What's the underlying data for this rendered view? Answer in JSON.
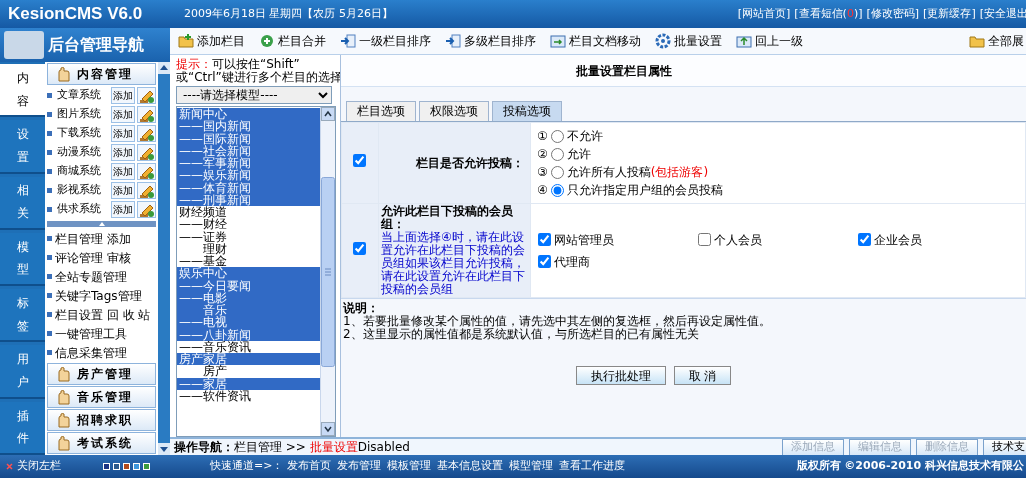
{
  "header": {
    "logo": "KesionCMS V6.0",
    "date": "2009年6月18日 星期四【农历 5月26日】",
    "links": [
      {
        "text": "[网站首页]"
      },
      {
        "text": "[查看短信(",
        "count": "0",
        "after": ")]"
      },
      {
        "text": "[修改密码]"
      },
      {
        "text": "[更新缓存]"
      },
      {
        "text": "[安全退出"
      }
    ]
  },
  "sidebar": {
    "title": "后台管理导航",
    "vtabs": [
      {
        "label": "内容",
        "selected": true
      },
      {
        "label": "设置",
        "selected": false
      },
      {
        "label": "相关",
        "selected": false
      },
      {
        "label": "模型",
        "selected": false
      },
      {
        "label": "标签",
        "selected": false
      },
      {
        "label": "用户",
        "selected": false
      },
      {
        "label": "插件",
        "selected": false
      }
    ],
    "menu": [
      {
        "kind": "header",
        "label": "内容管理"
      },
      {
        "kind": "system",
        "label": "文章系统",
        "button": "添加"
      },
      {
        "kind": "system",
        "label": "图片系统",
        "button": "添加"
      },
      {
        "kind": "system",
        "label": "下载系统",
        "button": "添加"
      },
      {
        "kind": "system",
        "label": "动漫系统",
        "button": "添加"
      },
      {
        "kind": "system",
        "label": "商城系统",
        "button": "添加"
      },
      {
        "kind": "system",
        "label": "影视系统",
        "button": "添加"
      },
      {
        "kind": "system",
        "label": "供求系统",
        "button": "添加"
      },
      {
        "kind": "collapse"
      },
      {
        "kind": "link",
        "label": "栏目管理 添加"
      },
      {
        "kind": "link",
        "label": "评论管理 审核"
      },
      {
        "kind": "link",
        "label": "全站专题管理"
      },
      {
        "kind": "link",
        "label": "关键字Tags管理"
      },
      {
        "kind": "link",
        "label": "栏目设置 回 收 站"
      },
      {
        "kind": "link",
        "label": "一键管理工具"
      },
      {
        "kind": "link",
        "label": "信息采集管理"
      },
      {
        "kind": "header",
        "label": "房产管理"
      },
      {
        "kind": "header",
        "label": "音乐管理"
      },
      {
        "kind": "header",
        "label": "招聘求职"
      },
      {
        "kind": "header",
        "label": "考试系统"
      }
    ]
  },
  "toolbar": {
    "items": [
      {
        "kind": "add",
        "label": "添加栏目"
      },
      {
        "kind": "merge",
        "label": "栏目合并"
      },
      {
        "kind": "sort",
        "label": "一级栏目排序"
      },
      {
        "kind": "sort",
        "label": "多级栏目排序"
      },
      {
        "kind": "move",
        "label": "栏目文档移动"
      },
      {
        "kind": "settings",
        "label": "批量设置"
      },
      {
        "kind": "up",
        "label": "回上一级"
      }
    ],
    "expand_all": "全部展"
  },
  "models": {
    "hint_label": "提示：",
    "hint": "可以按住“Shift”",
    "hint2": "或“Ctrl”键进行多个栏目的选择",
    "select": "----请选择模型----",
    "columns": [
      {
        "text": "新闻中心",
        "selected": true
      },
      {
        "text": "——国内新闻",
        "selected": true
      },
      {
        "text": "——国际新闻",
        "selected": true
      },
      {
        "text": "——社会新闻",
        "selected": true
      },
      {
        "text": "——军事新闻",
        "selected": true
      },
      {
        "text": "——娱乐新闻",
        "selected": true
      },
      {
        "text": "——体育新闻",
        "selected": true
      },
      {
        "text": "——刑事新闻",
        "selected": true
      },
      {
        "text": "财经频道",
        "selected": false
      },
      {
        "text": "——财经",
        "selected": false
      },
      {
        "text": "——证券",
        "selected": false
      },
      {
        "text": "　　理财",
        "selected": false
      },
      {
        "text": "——基金",
        "selected": false
      },
      {
        "text": "娱乐中心",
        "selected": true
      },
      {
        "text": "——今日要闻",
        "selected": true
      },
      {
        "text": "——电影",
        "selected": true
      },
      {
        "text": "　　音乐",
        "selected": true
      },
      {
        "text": "——电视",
        "selected": true
      },
      {
        "text": "——八卦新闻",
        "selected": true
      },
      {
        "text": "——音乐资讯",
        "selected": false
      },
      {
        "text": "房产家居",
        "selected": true
      },
      {
        "text": "　　房产",
        "selected": false
      },
      {
        "text": "——家居",
        "selected": true
      },
      {
        "text": "——软件资讯",
        "selected": false
      }
    ]
  },
  "main": {
    "title": "批量设置栏目属性",
    "tabs": [
      {
        "label": "栏目选项",
        "selected": false
      },
      {
        "label": "权限选项",
        "selected": false
      },
      {
        "label": "投稿选项",
        "selected": true
      }
    ],
    "allow_row": {
      "checked": true,
      "label": "栏目是否允许投稿：",
      "options": [
        {
          "num": "①",
          "label": "不允许",
          "selected": false
        },
        {
          "num": "②",
          "label": "允许",
          "selected": false
        },
        {
          "num": "③",
          "label": "允许所有人投稿",
          "note": "(包括游客)",
          "selected": false
        },
        {
          "num": "④",
          "label": "只允许指定用户组的会员投稿",
          "selected": true
        }
      ]
    },
    "groups_row": {
      "checked": true,
      "label": "允许此栏目下投稿的会员组：",
      "help": "当上面选择④时，请在此设置允许在此栏目下投稿的会员组如果该栏目允许投稿，请在此设置允许在此栏目下投稿的会员组",
      "groups": [
        {
          "label": "网站管理员",
          "checked": true
        },
        {
          "label": "个人会员",
          "checked": false
        },
        {
          "label": "企业会员",
          "checked": true
        },
        {
          "label": "代理商",
          "checked": true
        }
      ]
    },
    "notes_title": "说明：",
    "notes": [
      "1、若要批量修改某个属性的值，请先选中其左侧的复选框，然后再设定属性值。",
      "2、这里显示的属性值都是系统默认值，与所选栏目的已有属性无关"
    ],
    "buttons": [
      "执行批处理",
      "取 消"
    ]
  },
  "footer": {
    "nav_label": "操作导航：",
    "path": "栏目管理 >> ",
    "current": "批量设置",
    "status": "Disabled",
    "buttons": [
      {
        "label": "添加信息",
        "disabled": true
      },
      {
        "label": "编辑信息",
        "disabled": true
      },
      {
        "label": "删除信息",
        "disabled": true
      },
      {
        "label": "技术支",
        "disabled": false
      }
    ]
  },
  "bottombar": {
    "close": "关闭左栏",
    "swatches": [
      {
        "color": "#1c3584"
      },
      {
        "color": "#2d5a8c"
      },
      {
        "color": "#b04a1c"
      },
      {
        "color": "#3c96dc"
      },
      {
        "color": "#3c9c3c"
      }
    ],
    "quick_label": "快速通道=>：",
    "quick_links": [
      "发布首页",
      "发布管理",
      "模板管理",
      "基本信息设置",
      "模型管理",
      "查看工作进度"
    ],
    "copyright": "版权所有 ©2006-2010 科兴信息技术有限公"
  }
}
